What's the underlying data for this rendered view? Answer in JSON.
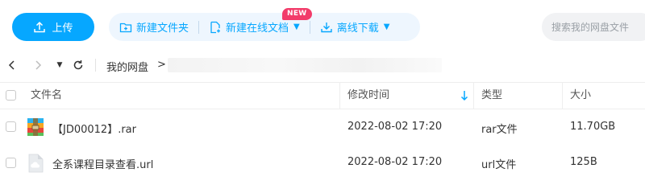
{
  "toolbar": {
    "upload_label": "上传",
    "new_folder_label": "新建文件夹",
    "new_doc_label": "新建在线文档",
    "offline_download_label": "离线下载",
    "new_badge": "NEW",
    "search_placeholder": "搜索我的网盘文件"
  },
  "nav": {
    "breadcrumb_root": "我的网盘",
    "breadcrumb_arrow": ">"
  },
  "table": {
    "headers": {
      "name": "文件名",
      "modified": "修改时间",
      "type": "类型",
      "size": "大小"
    },
    "rows": [
      {
        "name": "【JD00012】.rar",
        "modified": "2022-08-02 17:20",
        "type": "rar文件",
        "size": "11.70GB",
        "icon": "rar-archive-icon"
      },
      {
        "name": "全系课程目录查看.url",
        "modified": "2022-08-02 17:20",
        "type": "url文件",
        "size": "125B",
        "icon": "url-file-icon"
      }
    ]
  },
  "colors": {
    "accent": "#06a7ff",
    "pill_bg": "#eef6fe",
    "badge": "#f23c6a"
  }
}
